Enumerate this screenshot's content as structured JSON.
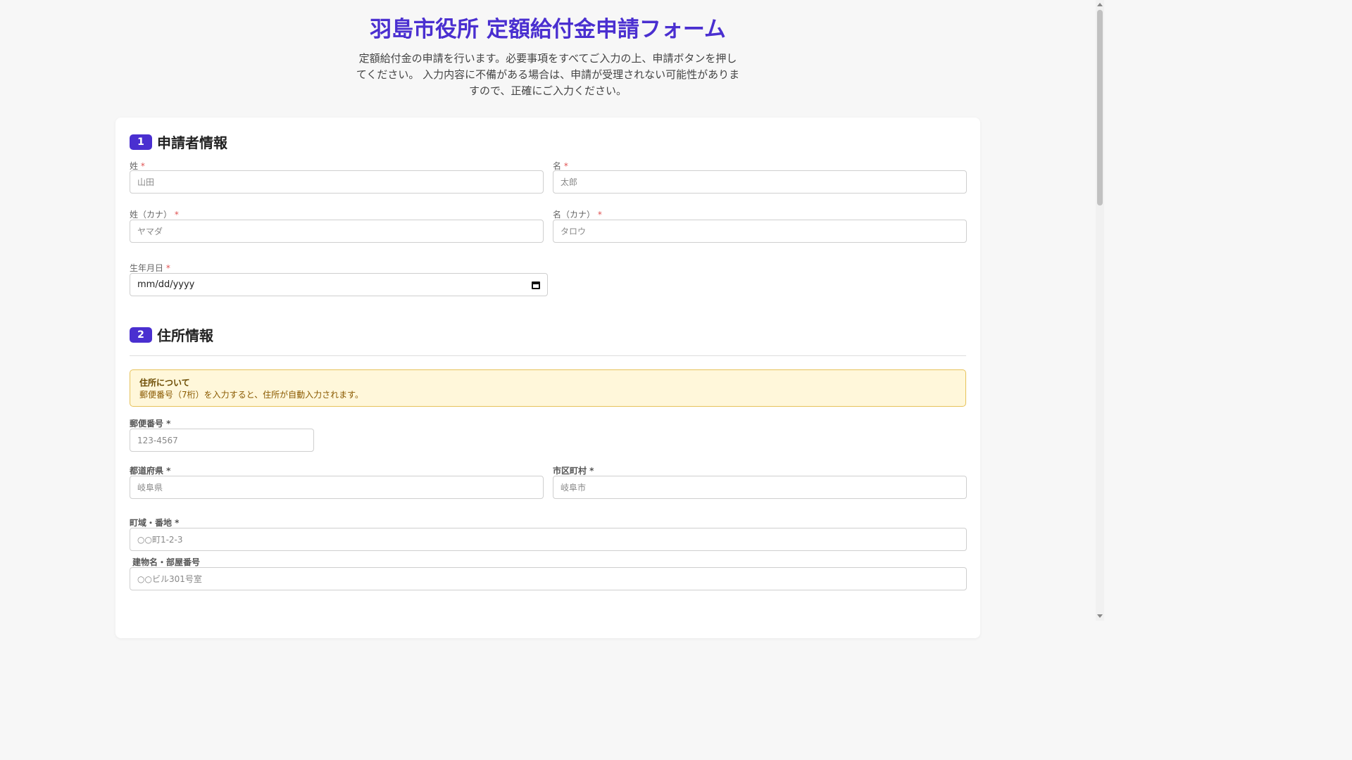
{
  "page": {
    "title": "羽島市役所 定額給付金申請フォーム",
    "intro": "定額給付金の申請を行います。必要事項をすべてご入力の上、申請ボタンを押してください。 入力内容に不備がある場合は、申請が受理されない可能性がありますので、正確にご入力ください。"
  },
  "section1": {
    "number": "1",
    "title": "申請者情報",
    "last_name": {
      "label": "姓",
      "required": "*",
      "placeholder": "山田"
    },
    "first_name": {
      "label": "名",
      "required": "*",
      "placeholder": "太郎"
    },
    "last_name_kana": {
      "label": "姓（カナ）",
      "required": "*",
      "placeholder": "ヤマダ"
    },
    "first_name_kana": {
      "label": "名（カナ）",
      "required": "*",
      "placeholder": "タロウ"
    },
    "birthdate": {
      "label": "生年月日",
      "required": "*",
      "value": "mm/dd/yyyy",
      "icon": "calendar-icon"
    }
  },
  "section2": {
    "number": "2",
    "title": "住所情報",
    "notice": {
      "title": "住所について",
      "text": "郵便番号（7桁）を入力すると、住所が自動入力されます。"
    },
    "postal_code": {
      "label": "郵便番号 *",
      "placeholder": "123-4567"
    },
    "prefecture": {
      "label": "都道府県 *",
      "placeholder": "岐阜県"
    },
    "city": {
      "label": "市区町村 *",
      "placeholder": "岐阜市"
    },
    "town": {
      "label": "町域・番地 *",
      "placeholder": "○○町1-2-3"
    },
    "building": {
      "label": "建物名・部屋番号",
      "placeholder": "○○ビル301号室"
    }
  },
  "colors": {
    "accent": "#4a2fd0",
    "required": "#e05353",
    "notice_bg": "#fff7da",
    "notice_border": "#e6c25a"
  }
}
